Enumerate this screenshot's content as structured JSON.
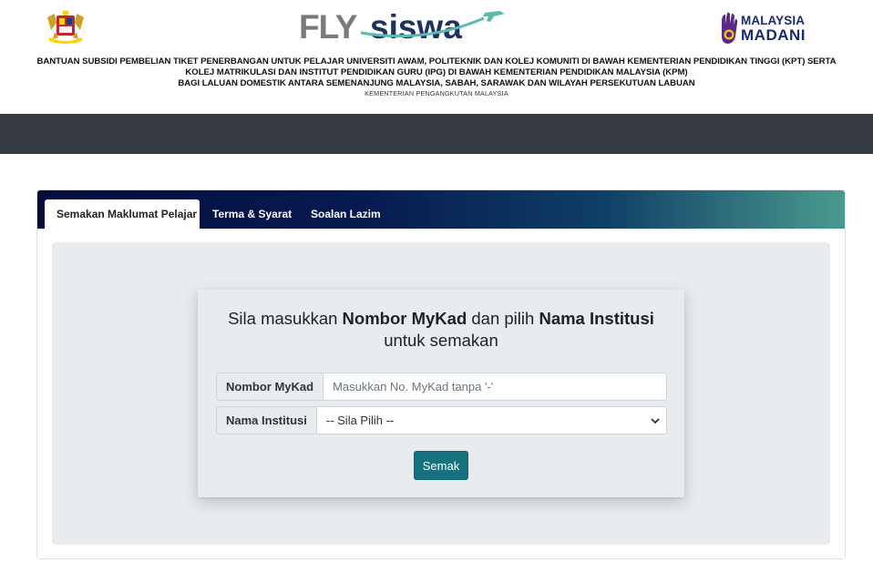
{
  "header": {
    "logo_text_fly": "FLY",
    "logo_text_siswa": "siswa",
    "madani_line1": "MALAYSIA",
    "madani_line2": "MADANI",
    "banner_line1": "BANTUAN SUBSIDI PEMBELIAN TIKET PENERBANGAN UNTUK PELAJAR UNIVERSITI AWAM, POLITEKNIK DAN KOLEJ KOMUNITI DI BAWAH KEMENTERIAN PENDIDIKAN TINGGI (KPT) SERTA",
    "banner_line2": "KOLEJ MATRIKULASI DAN INSTITUT PENDIDIKAN GURU (IPG) DI BAWAH KEMENTERIAN PENDIDIKAN MALAYSIA (KPM)",
    "banner_line3": "BAGI LALUAN DOMESTIK ANTARA SEMENANJUNG MALAYSIA, SABAH, SARAWAK DAN WILAYAH PERSEKUTUAN LABUAN",
    "ministry": "KEMENTERIAN PENGANGKUTAN MALAYSIA"
  },
  "tabs": [
    {
      "label": "Semakan Maklumat Pelajar"
    },
    {
      "label": "Terma & Syarat"
    },
    {
      "label": "Soalan Lazim"
    }
  ],
  "form": {
    "title_part1": "Sila masukkan ",
    "title_bold1": "Nombor MyKad",
    "title_part2": " dan pilih ",
    "title_bold2": "Nama Institusi",
    "title_part3": "untuk semakan",
    "mykad_label": "Nombor MyKad",
    "mykad_placeholder": "Masukkan No. MyKad tanpa '-'",
    "institusi_label": "Nama Institusi",
    "institusi_selected": "-- Sila Pilih --",
    "submit_label": "Semak"
  },
  "colors": {
    "navbar": "#343a40",
    "button": "#17717f",
    "panel": "#e9ecef"
  }
}
